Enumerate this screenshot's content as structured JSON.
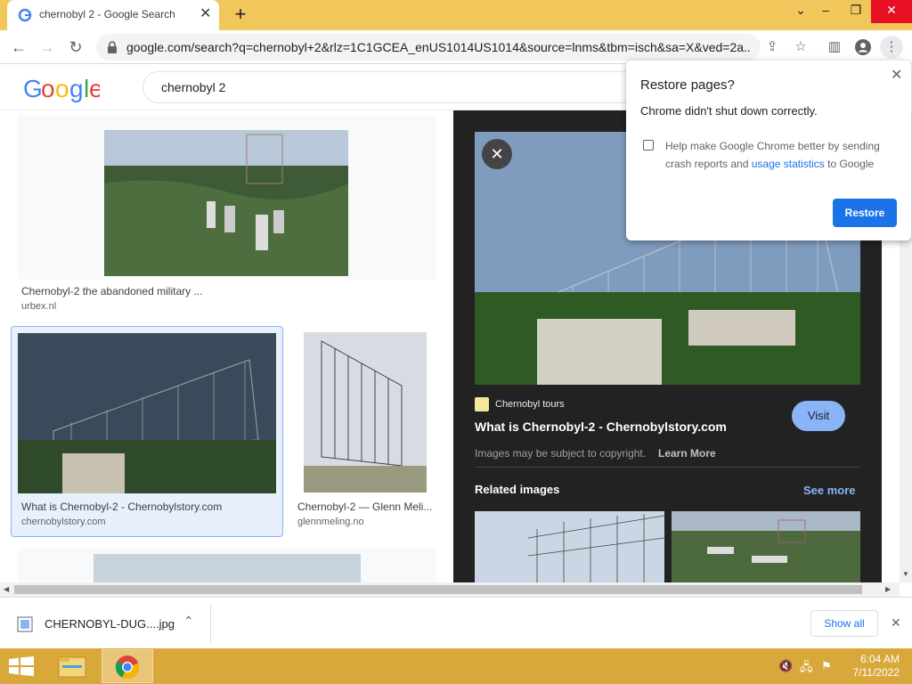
{
  "browser": {
    "tab_title": "chernobyl 2 - Google Search",
    "url": "google.com/search?q=chernobyl+2&rlz=1C1GCEA_enUS1014US1014&source=lnms&tbm=isch&sa=X&ved=2a..."
  },
  "search": {
    "logo": "Google",
    "query": "chernobyl 2"
  },
  "results": [
    {
      "caption": "Chernobyl-2 the abandoned military ...",
      "source": "urbex.nl"
    },
    {
      "caption": "What is Chernobyl-2 - Chernobylstory.com",
      "source": "chernobylstory.com"
    },
    {
      "caption": "Chernobyl-2 — Glenn Meli...",
      "source": "glennmeling.no"
    }
  ],
  "preview": {
    "site_name": "Chernobyl tours",
    "title": "What is Chernobyl-2 - Chernobylstory.com",
    "copyright_note": "Images may be subject to copyright.",
    "learn_more": "Learn More",
    "visit_label": "Visit",
    "related_label": "Related images",
    "see_more_label": "See more"
  },
  "popup": {
    "title": "Restore pages?",
    "message": "Chrome didn't shut down correctly.",
    "help_prefix": "Help make Google Chrome better by sending crash reports and",
    "help_link": "usage statistics",
    "help_suffix": "to Google",
    "restore_label": "Restore"
  },
  "downloads": {
    "file_name": "CHERNOBYL-DUG....jpg",
    "show_all_label": "Show all"
  },
  "taskbar": {
    "time": "6:04 AM",
    "date": "7/11/2022"
  },
  "colors": {
    "titlebar": "#f1c65a",
    "taskbar": "#d9a83a",
    "accent": "#1a73e8",
    "preview_bg": "#222222"
  }
}
